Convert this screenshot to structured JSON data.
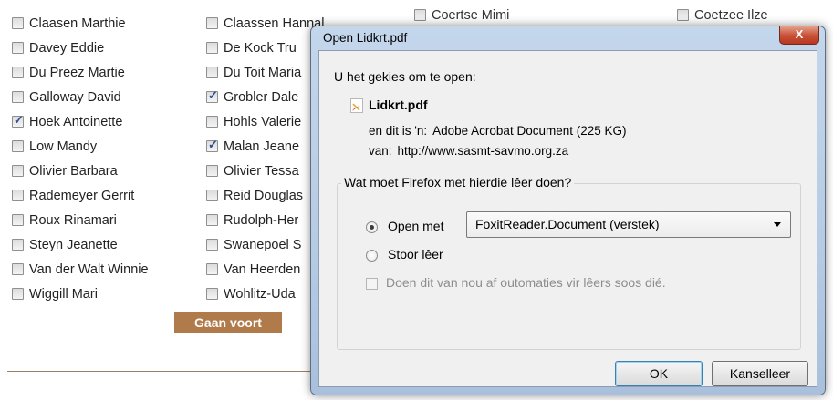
{
  "page": {
    "column1": [
      {
        "label": "Claasen Marthie",
        "checked": false
      },
      {
        "label": "Davey Eddie",
        "checked": false
      },
      {
        "label": "Du Preez Martie",
        "checked": false
      },
      {
        "label": "Galloway David",
        "checked": false
      },
      {
        "label": "Hoek Antoinette",
        "checked": true
      },
      {
        "label": "Low Mandy",
        "checked": false
      },
      {
        "label": "Olivier Barbara",
        "checked": false
      },
      {
        "label": "Rademeyer Gerrit",
        "checked": false
      },
      {
        "label": "Roux Rinamari",
        "checked": false
      },
      {
        "label": "Steyn Jeanette",
        "checked": false
      },
      {
        "label": "Van der Walt Winnie",
        "checked": false
      },
      {
        "label": "Wiggill Mari",
        "checked": false
      }
    ],
    "column2": [
      {
        "label": "Claassen Hannalie",
        "checked": false
      },
      {
        "label": "De Kock Tru",
        "checked": false
      },
      {
        "label": "Du Toit Maria",
        "checked": false
      },
      {
        "label": "Grobler Dale",
        "checked": true
      },
      {
        "label": "Hohls Valerie",
        "checked": false
      },
      {
        "label": "Malan Jeane",
        "checked": true
      },
      {
        "label": "Olivier Tessa",
        "checked": false
      },
      {
        "label": "Reid Douglas",
        "checked": false
      },
      {
        "label": "Rudolph-Her",
        "checked": false
      },
      {
        "label": "Swanepoel S",
        "checked": false
      },
      {
        "label": "Van Heerden",
        "checked": false
      },
      {
        "label": "Wohlitz-Uda",
        "checked": false
      }
    ],
    "column3": [
      {
        "label": "Coertse Mimi",
        "checked": false
      }
    ],
    "column4": [
      {
        "label": "Coetzee Ilze",
        "checked": false
      }
    ],
    "continue_button": "Gaan voort"
  },
  "dialog": {
    "title": "Open Lidkrt.pdf",
    "close_label": "X",
    "intro": "U het gekies om te open:",
    "file_name": "Lidkrt.pdf",
    "type_label": "en dit is 'n:",
    "type_value": "Adobe Acrobat Document (225 KG)",
    "from_label": "van:",
    "from_value": "http://www.sasmt-savmo.org.za",
    "question": "Wat moet Firefox met hierdie lêer doen?",
    "open_with_label": "Open met",
    "open_with_value": "FoxitReader.Document (verstek)",
    "save_label": "Stoor lêer",
    "auto_label": "Doen dit van nou af outomaties vir lêers soos dié.",
    "ok_label": "OK",
    "cancel_label": "Kanselleer",
    "selected_option": "open"
  }
}
